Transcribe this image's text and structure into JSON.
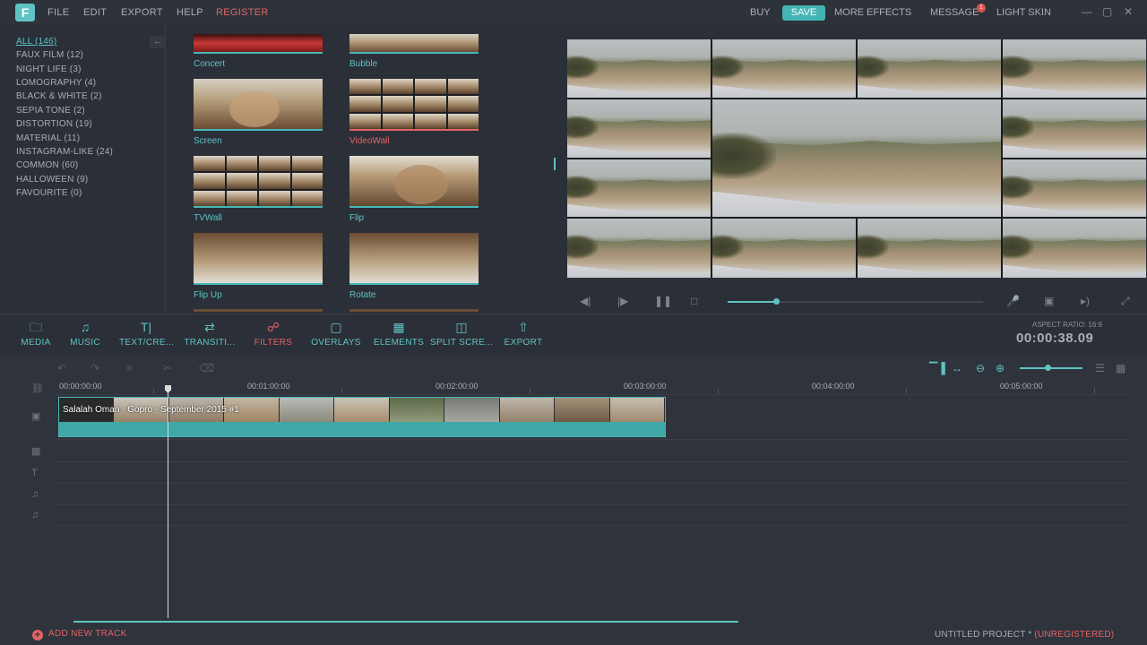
{
  "menu": {
    "logo": "F",
    "items": [
      "FILE",
      "EDIT",
      "EXPORT",
      "HELP"
    ],
    "register": "REGISTER",
    "right": {
      "buy": "BUY",
      "save": "SAVE",
      "more_effects": "MORE EFFECTS",
      "message": "MESSAGE",
      "message_count": "1",
      "light_skin": "LIGHT SKIN"
    },
    "window_controls": [
      "minimize-icon",
      "maximize-icon",
      "close-icon"
    ]
  },
  "categories": [
    "ALL (146)",
    "FAUX FILM (12)",
    "NIGHT LIFE (3)",
    "LOMOGRAPHY (4)",
    "BLACK & WHITE (2)",
    "SEPIA TONE (2)",
    "DISTORTION (19)",
    "MATERIAL (11)",
    "INSTAGRAM-LIKE (24)",
    "COMMON (60)",
    "HALLOWEEN (9)",
    "FAVOURITE (0)"
  ],
  "filters": [
    {
      "name": "Concert"
    },
    {
      "name": "Bubble"
    },
    {
      "name": "Screen"
    },
    {
      "name": "VideoWall"
    },
    {
      "name": "TVWall"
    },
    {
      "name": "Flip"
    },
    {
      "name": "Flip Up"
    },
    {
      "name": "Rotate"
    }
  ],
  "toolbar": {
    "items": [
      {
        "label": "MEDIA",
        "icon": "folder-icon"
      },
      {
        "label": "MUSIC",
        "icon": "music-note-icon"
      },
      {
        "label": "TEXT/CRE...",
        "icon": "text-icon"
      },
      {
        "label": "TRANSITI...",
        "icon": "transition-icon"
      },
      {
        "label": "FILTERS",
        "icon": "filters-icon"
      },
      {
        "label": "OVERLAYS",
        "icon": "overlay-icon"
      },
      {
        "label": "ELEMENTS",
        "icon": "image-icon"
      },
      {
        "label": "SPLIT SCRE...",
        "icon": "split-screen-icon"
      },
      {
        "label": "EXPORT",
        "icon": "export-icon"
      }
    ],
    "active": "FILTERS",
    "aspect_ratio": "ASPECT RATIO: 16:9",
    "timecode": "00:00:38.09"
  },
  "player": {
    "progress": 0.19
  },
  "timeline": {
    "ruler": [
      "00:00:00:00",
      "00:01:00:00",
      "00:02:00:00",
      "00:03:00:00",
      "00:04:00:00",
      "00:05:00:00"
    ],
    "clip_name": "Salalah Oman - Gopro - September 2015 #1",
    "add_track": "ADD NEW TRACK",
    "project_name": "UNTITLED PROJECT *",
    "unregistered": "(UNREGISTERED)"
  },
  "colors": {
    "accent": "#5fc3c3",
    "alert": "#e06464",
    "background": "#2b2f38"
  }
}
